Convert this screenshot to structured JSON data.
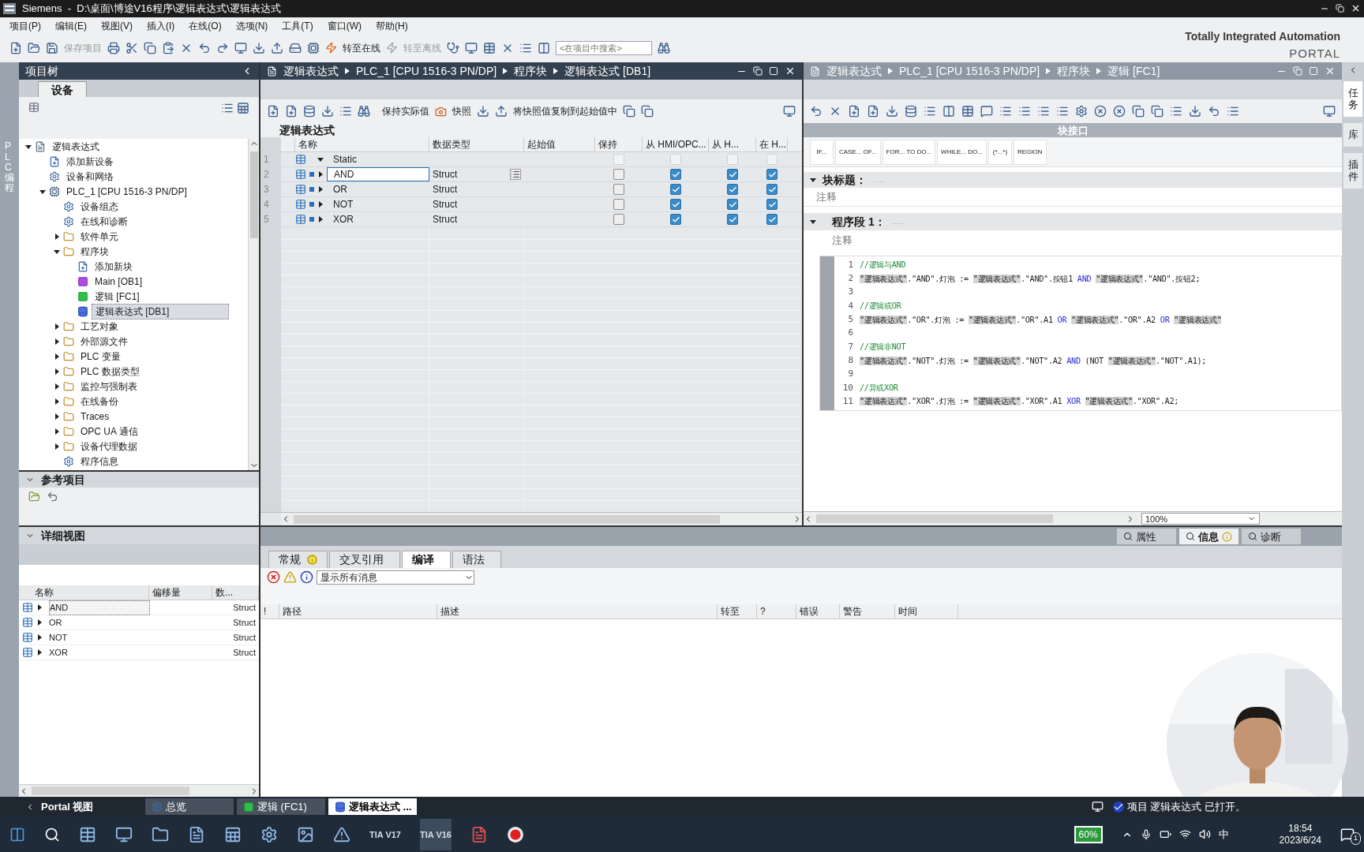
{
  "window": {
    "title": "Siemens  -  D:\\桌面\\博途V16程序\\逻辑表达式\\逻辑表达式"
  },
  "menu": [
    "项目(P)",
    "编辑(E)",
    "视图(V)",
    "插入(I)",
    "在线(O)",
    "选项(N)",
    "工具(T)",
    "窗口(W)",
    "帮助(H)"
  ],
  "toolbar": {
    "labels": [
      {
        "label": "保存项目",
        "disabled": true
      },
      {
        "label": "转至在线",
        "disabled": false
      },
      {
        "label": "转至离线",
        "disabled": true
      }
    ],
    "search": {
      "placeholder": "<在项目中搜索>"
    }
  },
  "brand": {
    "line1": "Totally Integrated Automation",
    "line2": "PORTAL"
  },
  "left_strip": {
    "label": "PLC 编程"
  },
  "project_tree": {
    "title": "项目树",
    "tab": "设备",
    "items": [
      {
        "label": "逻辑表达式",
        "kind": "project",
        "selected": false,
        "expanded": true,
        "children": [
          {
            "label": "添加新设备",
            "kind": "add",
            "selected": false
          },
          {
            "label": "设备和网络",
            "kind": "item",
            "selected": false
          },
          {
            "label": "PLC_1 [CPU 1516-3 PN/DP]",
            "kind": "device",
            "selected": false,
            "expanded": true,
            "children": [
              {
                "label": "设备组态",
                "kind": "item",
                "selected": false
              },
              {
                "label": "在线和诊断",
                "kind": "item",
                "selected": false
              },
              {
                "label": "软件单元",
                "kind": "folder",
                "selected": false,
                "expanded": false
              },
              {
                "label": "程序块",
                "kind": "folder",
                "selected": false,
                "expanded": true,
                "children": [
                  {
                    "label": "添加新块",
                    "kind": "add",
                    "selected": false
                  },
                  {
                    "label": "Main [OB1]",
                    "kind": "ob",
                    "selected": false
                  },
                  {
                    "label": "逻辑 [FC1]",
                    "kind": "fc",
                    "selected": false
                  },
                  {
                    "label": "逻辑表达式 [DB1]",
                    "kind": "db",
                    "selected": true
                  }
                ]
              },
              {
                "label": "工艺对象",
                "kind": "folder",
                "selected": false,
                "expanded": false
              },
              {
                "label": "外部源文件",
                "kind": "folder",
                "selected": false,
                "expanded": false
              },
              {
                "label": "PLC 变量",
                "kind": "folder",
                "selected": false,
                "expanded": false
              },
              {
                "label": "PLC 数据类型",
                "kind": "folder",
                "selected": false,
                "expanded": false
              },
              {
                "label": "监控与强制表",
                "kind": "folder",
                "selected": false,
                "expanded": false
              },
              {
                "label": "在线备份",
                "kind": "folder",
                "selected": false,
                "expanded": false
              },
              {
                "label": "Traces",
                "kind": "folder",
                "selected": false,
                "expanded": false
              },
              {
                "label": "OPC UA 通信",
                "kind": "folder",
                "selected": false,
                "expanded": false
              },
              {
                "label": "设备代理数据",
                "kind": "folder",
                "selected": false,
                "expanded": false
              },
              {
                "label": "程序信息",
                "kind": "item",
                "selected": false
              }
            ]
          }
        ]
      }
    ]
  },
  "reference_projects": {
    "title": "参考项目"
  },
  "details_view": {
    "title": "详细视图",
    "columns": [
      "名称",
      "偏移量",
      "数..."
    ],
    "rows": [
      {
        "name": "AND",
        "type": "Struct",
        "selected": true
      },
      {
        "name": "OR",
        "type": "Struct",
        "selected": false
      },
      {
        "name": "NOT",
        "type": "Struct",
        "selected": false
      },
      {
        "name": "XOR",
        "type": "Struct",
        "selected": false
      }
    ]
  },
  "db_editor": {
    "breadcrumb": [
      "逻辑表达式",
      "PLC_1 [CPU 1516-3 PN/DP]",
      "程序块",
      "逻辑表达式 [DB1]"
    ],
    "toolbar_labels": [
      "保持实际值",
      "快照",
      "将快照值复制到起始值中"
    ],
    "title": "逻辑表达式",
    "columns": [
      "名称",
      "数据类型",
      "起始值",
      "保持",
      "从 HMI/OPC...",
      "从 H...",
      "在 H..."
    ],
    "rows": [
      {
        "number": "1",
        "kind": "section",
        "name": "Static",
        "expanded": true,
        "selected": false,
        "checks": [
          false,
          false,
          false,
          false
        ]
      },
      {
        "number": "2",
        "kind": "member",
        "name": "AND",
        "type": "Struct",
        "expanded": false,
        "selected": true,
        "checks": [
          false,
          true,
          true,
          true
        ]
      },
      {
        "number": "3",
        "kind": "member",
        "name": "OR",
        "type": "Struct",
        "expanded": false,
        "selected": false,
        "checks": [
          false,
          true,
          true,
          true
        ]
      },
      {
        "number": "4",
        "kind": "member",
        "name": "NOT",
        "type": "Struct",
        "expanded": false,
        "selected": false,
        "checks": [
          false,
          true,
          true,
          true
        ]
      },
      {
        "number": "5",
        "kind": "member",
        "name": "XOR",
        "type": "Struct",
        "expanded": false,
        "selected": false,
        "checks": [
          false,
          true,
          true,
          true
        ]
      }
    ]
  },
  "fc_editor": {
    "breadcrumb": [
      "逻辑表达式",
      "PLC_1 [CPU 1516-3 PN/DP]",
      "程序块",
      "逻辑 [FC1]"
    ],
    "interface_label": "块接口",
    "instructions": [
      "IF...",
      "CASE... OF...",
      "FOR... TO DO...",
      "WHILE... DO...",
      "(*...*)",
      "REGION"
    ],
    "block_title": {
      "label": "块标题：",
      "value": "......",
      "comment": "注释"
    },
    "network": {
      "label": "程序段 1：",
      "value": "......",
      "comment": "注释"
    },
    "code": [
      {
        "number": "1",
        "parts": [
          {
            "kind": "comment",
            "text": "//逻辑与AND"
          }
        ]
      },
      {
        "number": "2",
        "parts": [
          {
            "kind": "tag",
            "text": "\"逻辑表达式\""
          },
          {
            "kind": "text",
            "text": ".\"AND\".灯泡 := "
          },
          {
            "kind": "tag",
            "text": "\"逻辑表达式\""
          },
          {
            "kind": "text",
            "text": ".\"AND\".按钮1 "
          },
          {
            "kind": "keyword",
            "text": "AND "
          },
          {
            "kind": "tag",
            "text": "\"逻辑表达式\""
          },
          {
            "kind": "text",
            "text": ".\"AND\".按钮2;"
          }
        ]
      },
      {
        "number": "3"
      },
      {
        "number": "4",
        "parts": [
          {
            "kind": "comment",
            "text": "//逻辑或OR"
          }
        ]
      },
      {
        "number": "5",
        "parts": [
          {
            "kind": "tag",
            "text": "\"逻辑表达式\""
          },
          {
            "kind": "text",
            "text": ".\"OR\".灯泡 := "
          },
          {
            "kind": "tag",
            "text": "\"逻辑表达式\""
          },
          {
            "kind": "text",
            "text": ".\"OR\".A1 "
          },
          {
            "kind": "keyword",
            "text": "OR "
          },
          {
            "kind": "tag",
            "text": "\"逻辑表达式\""
          },
          {
            "kind": "text",
            "text": ".\"OR\".A2 "
          },
          {
            "kind": "keyword",
            "text": "OR "
          },
          {
            "kind": "tag",
            "text": "\"逻辑表达式\""
          }
        ]
      },
      {
        "number": "6"
      },
      {
        "number": "7",
        "parts": [
          {
            "kind": "comment",
            "text": "//逻辑非NOT"
          }
        ]
      },
      {
        "number": "8",
        "parts": [
          {
            "kind": "tag",
            "text": "\"逻辑表达式\""
          },
          {
            "kind": "text",
            "text": ".\"NOT\".灯泡 := "
          },
          {
            "kind": "tag",
            "text": "\"逻辑表达式\""
          },
          {
            "kind": "text",
            "text": ".\"NOT\".A2 "
          },
          {
            "kind": "keyword",
            "text": "AND"
          },
          {
            "kind": "text",
            "text": " (NOT "
          },
          {
            "kind": "tag",
            "text": "\"逻辑表达式\""
          },
          {
            "kind": "text",
            "text": ".\"NOT\".A1);"
          }
        ]
      },
      {
        "number": "9"
      },
      {
        "number": "10",
        "parts": [
          {
            "kind": "comment",
            "text": "//异或XOR"
          }
        ]
      },
      {
        "number": "11",
        "parts": [
          {
            "kind": "tag",
            "text": "\"逻辑表达式\""
          },
          {
            "kind": "text",
            "text": ".\"XOR\".灯泡 := "
          },
          {
            "kind": "tag",
            "text": "\"逻辑表达式\""
          },
          {
            "kind": "text",
            "text": ".\"XOR\".A1 "
          },
          {
            "kind": "keyword",
            "text": "XOR "
          },
          {
            "kind": "tag",
            "text": "\"逻辑表达式\""
          },
          {
            "kind": "text",
            "text": ".\"XOR\".A2;"
          }
        ]
      }
    ],
    "zoom": "100%"
  },
  "right_strip": [
    {
      "label": "任务",
      "selected": true
    },
    {
      "label": "库",
      "selected": false
    },
    {
      "label": "插件",
      "selected": false
    }
  ],
  "inspector": {
    "top_tabs": [
      {
        "label": "属性",
        "selected": false,
        "info": false
      },
      {
        "label": "信息",
        "selected": true,
        "info": true
      },
      {
        "label": "诊断",
        "selected": false,
        "info": false
      }
    ],
    "tabs": [
      {
        "label": "常规",
        "selected": false,
        "info": true
      },
      {
        "label": "交叉引用",
        "selected": false,
        "info": false
      },
      {
        "label": "编译",
        "selected": true,
        "info": false
      },
      {
        "label": "语法",
        "selected": false,
        "info": false
      }
    ],
    "filter": "显示所有消息",
    "columns": [
      "!",
      "路径",
      "描述",
      "转至",
      "?",
      "错误",
      "警告",
      "时间"
    ]
  },
  "portal_bar": {
    "portal": "Portal 视图",
    "editors": [
      {
        "label": "总览",
        "kind": "overview",
        "selected": false
      },
      {
        "label": "逻辑 (FC1)",
        "kind": "fc",
        "selected": false
      },
      {
        "label": "逻辑表达式 ...",
        "kind": "db",
        "selected": true
      }
    ],
    "status": "项目 逻辑表达式 已打开。"
  },
  "taskbar": {
    "apps": [
      {
        "label": "TIA V17",
        "selected": false
      },
      {
        "label": "TIA V16",
        "selected": true
      }
    ],
    "battery": "60%",
    "ime": "中",
    "time": "18:54",
    "date": "2023/6/24",
    "notifications": "1"
  }
}
